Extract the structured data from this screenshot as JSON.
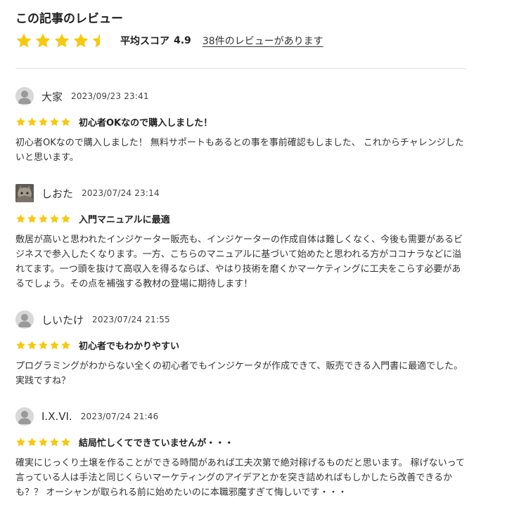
{
  "section": {
    "title": "この記事のレビュー"
  },
  "summary": {
    "rating_value": 4.5,
    "average_label": "平均スコア",
    "average_score": "4.9",
    "review_count_link": "38件のレビューがあります"
  },
  "colors": {
    "star": "#f6c90e",
    "star_empty": "#e6e6e6",
    "avatar_bg": "#d8d8d8",
    "avatar_fg": "#9a9a9a"
  },
  "reviews": [
    {
      "name": "大家",
      "date": "2023/09/23 23:41",
      "avatar": "person-icon",
      "stars": 5,
      "title": "初心者OKなので購入しました！",
      "body": "初心者OKなので購入しました！ 無料サポートもあるとの事を事前確認もしました、 これからチャレンジしたいと思います。"
    },
    {
      "name": "しおた",
      "date": "2023/07/24 23:14",
      "avatar": "cat-photo",
      "stars": 5,
      "title": "入門マニュアルに最適",
      "body": "敷居が高いと思われたインジケーター販売も、インジケーターの作成自体は難しくなく、今後も需要があるビジネスで参入したくなります。一方、こちらのマニュアルに基づいて始めたと思われる方がココナラなどに溢れてます。一つ頭を抜けて高収入を得るならば、やはり技術を磨くかマーケティングに工夫をこらす必要があるでしょう。その点を補強する教材の登場に期待します！"
    },
    {
      "name": "しいたけ",
      "date": "2023/07/24 21:55",
      "avatar": "person-icon",
      "stars": 5,
      "title": "初心者でもわかりやすい",
      "body": "プログラミングがわからない全くの初心者でもインジケータが作成できて、販売できる入門書に最適でした。実践ですね？"
    },
    {
      "name": "I.X.VI.",
      "date": "2023/07/24 21:46",
      "avatar": "person-icon",
      "stars": 5,
      "title": "結局忙しくてできていませんが・・・",
      "body": "確実にじっくり土壌を作ることができる時間があれば工夫次第で絶対稼げるものだと思います。 稼げないって言っている人は手法と同じくらいマーケティングのアイデアとかを突き詰めればもしかしたら改善できるかも？？ オーシャンが取られる前に始めたいのに本職邪魔すぎて悔しいです・・・"
    }
  ]
}
